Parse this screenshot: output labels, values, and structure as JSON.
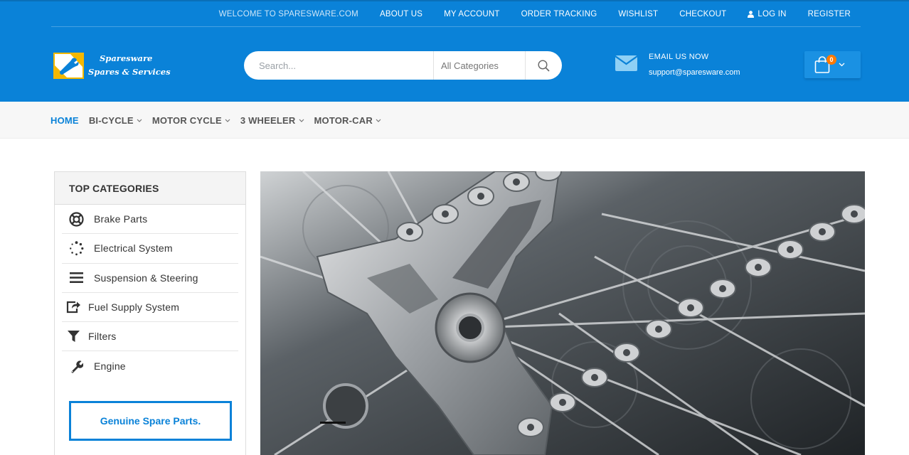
{
  "topbar": {
    "welcome": "WELCOME TO SPARESWARE.COM",
    "links": [
      "ABOUT US",
      "MY ACCOUNT",
      "ORDER TRACKING",
      "WISHLIST",
      "CHECKOUT"
    ],
    "login": "LOG IN",
    "register": "REGISTER"
  },
  "logo": {
    "line1": "Sparesware",
    "line2": "Spares & Services"
  },
  "search": {
    "placeholder": "Search...",
    "category": "All Categories",
    "icon": "search-icon"
  },
  "contact": {
    "label": "EMAIL US NOW",
    "email": "support@sparesware.com",
    "icon": "envelope-icon"
  },
  "cart": {
    "count": "0",
    "icon": "shopping-bag-icon"
  },
  "nav": {
    "items": [
      {
        "label": "HOME",
        "active": true
      },
      {
        "label": "BI-CYCLE",
        "dropdown": true
      },
      {
        "label": "MOTOR CYCLE",
        "dropdown": true
      },
      {
        "label": "3 WHEELER",
        "dropdown": true
      },
      {
        "label": "MOTOR-CAR",
        "dropdown": true
      }
    ]
  },
  "sidebar": {
    "title": "TOP CATEGORIES",
    "items": [
      {
        "label": "Brake Parts",
        "icon": "lifebuoy-icon"
      },
      {
        "label": "Electrical System",
        "icon": "spinner-icon"
      },
      {
        "label": "Suspension & Steering",
        "icon": "bars-icon"
      },
      {
        "label": "Fuel Supply System",
        "icon": "share-square-icon"
      },
      {
        "label": "Filters",
        "icon": "filter-icon"
      },
      {
        "label": "Engine",
        "icon": "wrench-icon"
      }
    ],
    "promo": "Genuine Spare Parts."
  },
  "colors": {
    "primary": "#0a82d8",
    "accent": "#ff7a00",
    "nav_bg": "#f7f7f7"
  }
}
